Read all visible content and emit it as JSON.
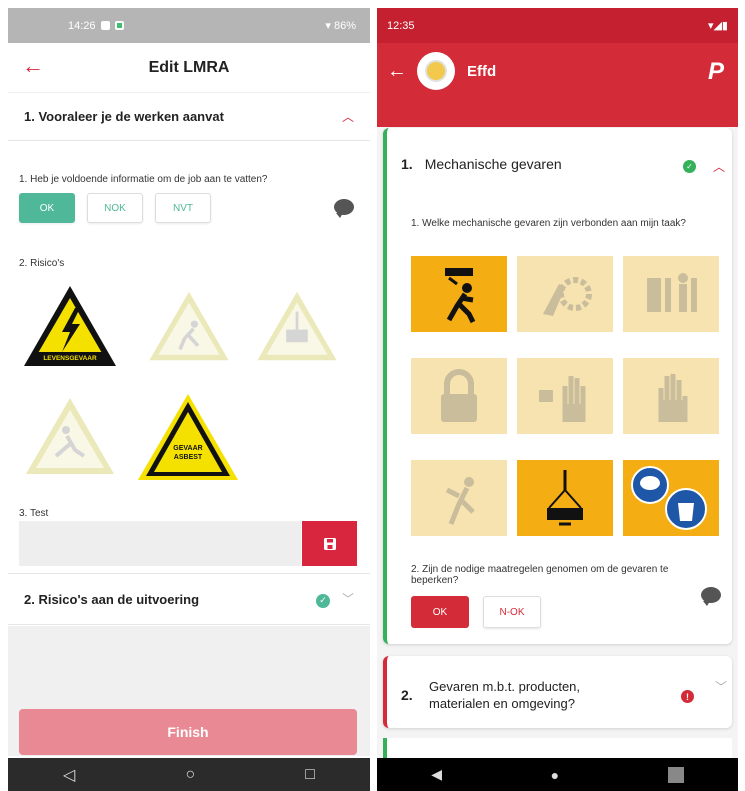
{
  "left": {
    "status": {
      "time": "14:26",
      "battery": "86%"
    },
    "appbar": {
      "back_icon": "arrow-left-icon",
      "title": "Edit LMRA"
    },
    "section1": {
      "title": "1. Vooraleer je de werken aanvat",
      "q1": {
        "text": "1. Heb je voldoende informatie om de job aan te vatten?",
        "options": [
          "OK",
          "NOK",
          "NVT"
        ],
        "selected": "OK"
      },
      "q2": {
        "text": "2. Risico's",
        "signs": [
          {
            "name": "levensgevaar",
            "label": "LEVENSGEVAAR",
            "selected": true
          },
          {
            "name": "fall-from-height",
            "label": "",
            "selected": false
          },
          {
            "name": "suspended-load",
            "label": "",
            "selected": false
          },
          {
            "name": "slip-hazard",
            "label": "",
            "selected": false
          },
          {
            "name": "gevaar-asbest",
            "label": "GEVAAR ASBEST",
            "selected": true
          }
        ]
      },
      "q3": {
        "text": "3. Test",
        "value": ""
      }
    },
    "section2": {
      "title": "2. Risico's aan de uitvoering"
    },
    "finish_label": "Finish",
    "accent": "#4fb898",
    "brand": "#d7263d"
  },
  "right": {
    "status": {
      "time": "12:35"
    },
    "appbar": {
      "back_icon": "arrow-left-icon",
      "name": "Effd",
      "logo": "P"
    },
    "card1": {
      "num": "1.",
      "title": "Mechanische gevaren",
      "q1": {
        "text": "1. Welke mechanische gevaren zijn verbonden aan mijn taak?",
        "tiles": [
          {
            "name": "falling-object",
            "selected": true
          },
          {
            "name": "gear-entanglement",
            "selected": false
          },
          {
            "name": "crushing-door",
            "selected": false
          },
          {
            "name": "padlock",
            "selected": false
          },
          {
            "name": "hand-plug",
            "selected": false
          },
          {
            "name": "glove",
            "selected": false
          },
          {
            "name": "impact",
            "selected": false
          },
          {
            "name": "suspended-load",
            "selected": true
          },
          {
            "name": "ppe-goggles-mask",
            "selected": true
          }
        ]
      },
      "q2": {
        "text": "2. Zijn de nodige maatregelen genomen om de gevaren te beperken?",
        "options": [
          "OK",
          "N-OK"
        ],
        "selected": "OK"
      }
    },
    "card2": {
      "num": "2.",
      "title": "Gevaren m.b.t. producten, materialen en omgeving?"
    },
    "brand": "#d42b38",
    "ok_color": "#34b15a"
  }
}
